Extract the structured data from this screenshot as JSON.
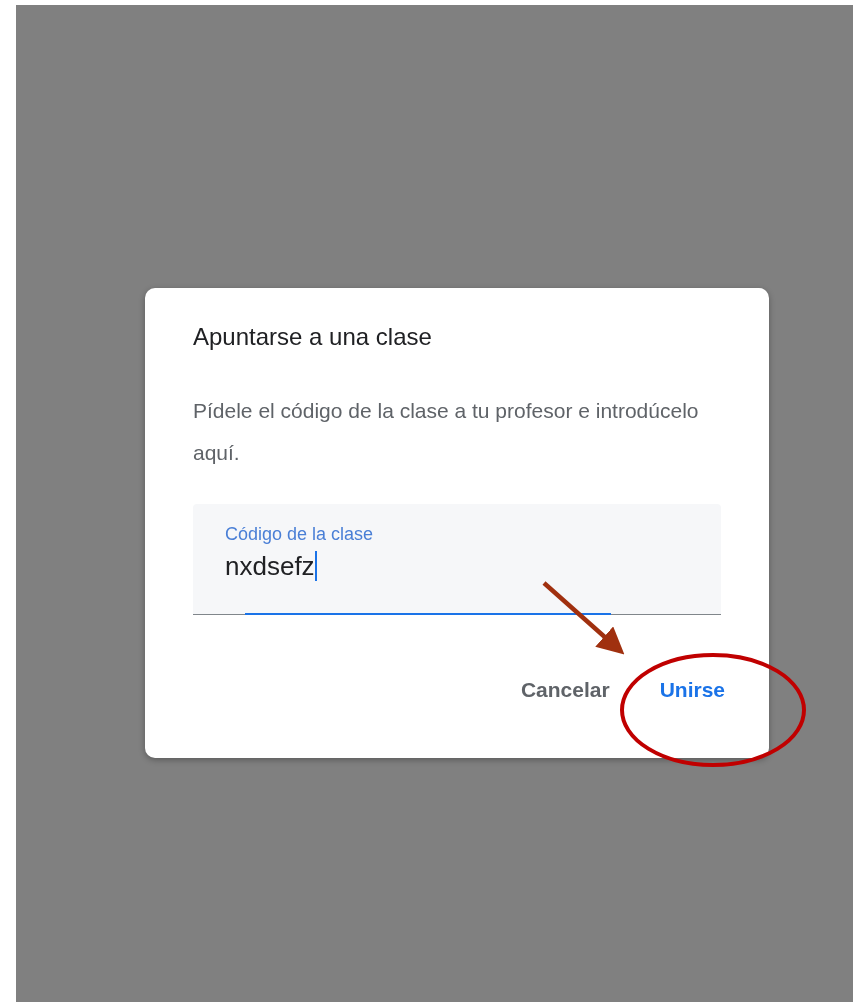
{
  "dialog": {
    "title": "Apuntarse a una clase",
    "description": "Pídele el código de la clase a tu profesor e introdúcelo aquí.",
    "field": {
      "label": "Código de la clase",
      "value": "nxdsefz",
      "focused": true
    },
    "buttons": [
      {
        "label": "Cancelar",
        "kind": "secondary"
      },
      {
        "label": "Unirse",
        "kind": "primary"
      }
    ]
  }
}
